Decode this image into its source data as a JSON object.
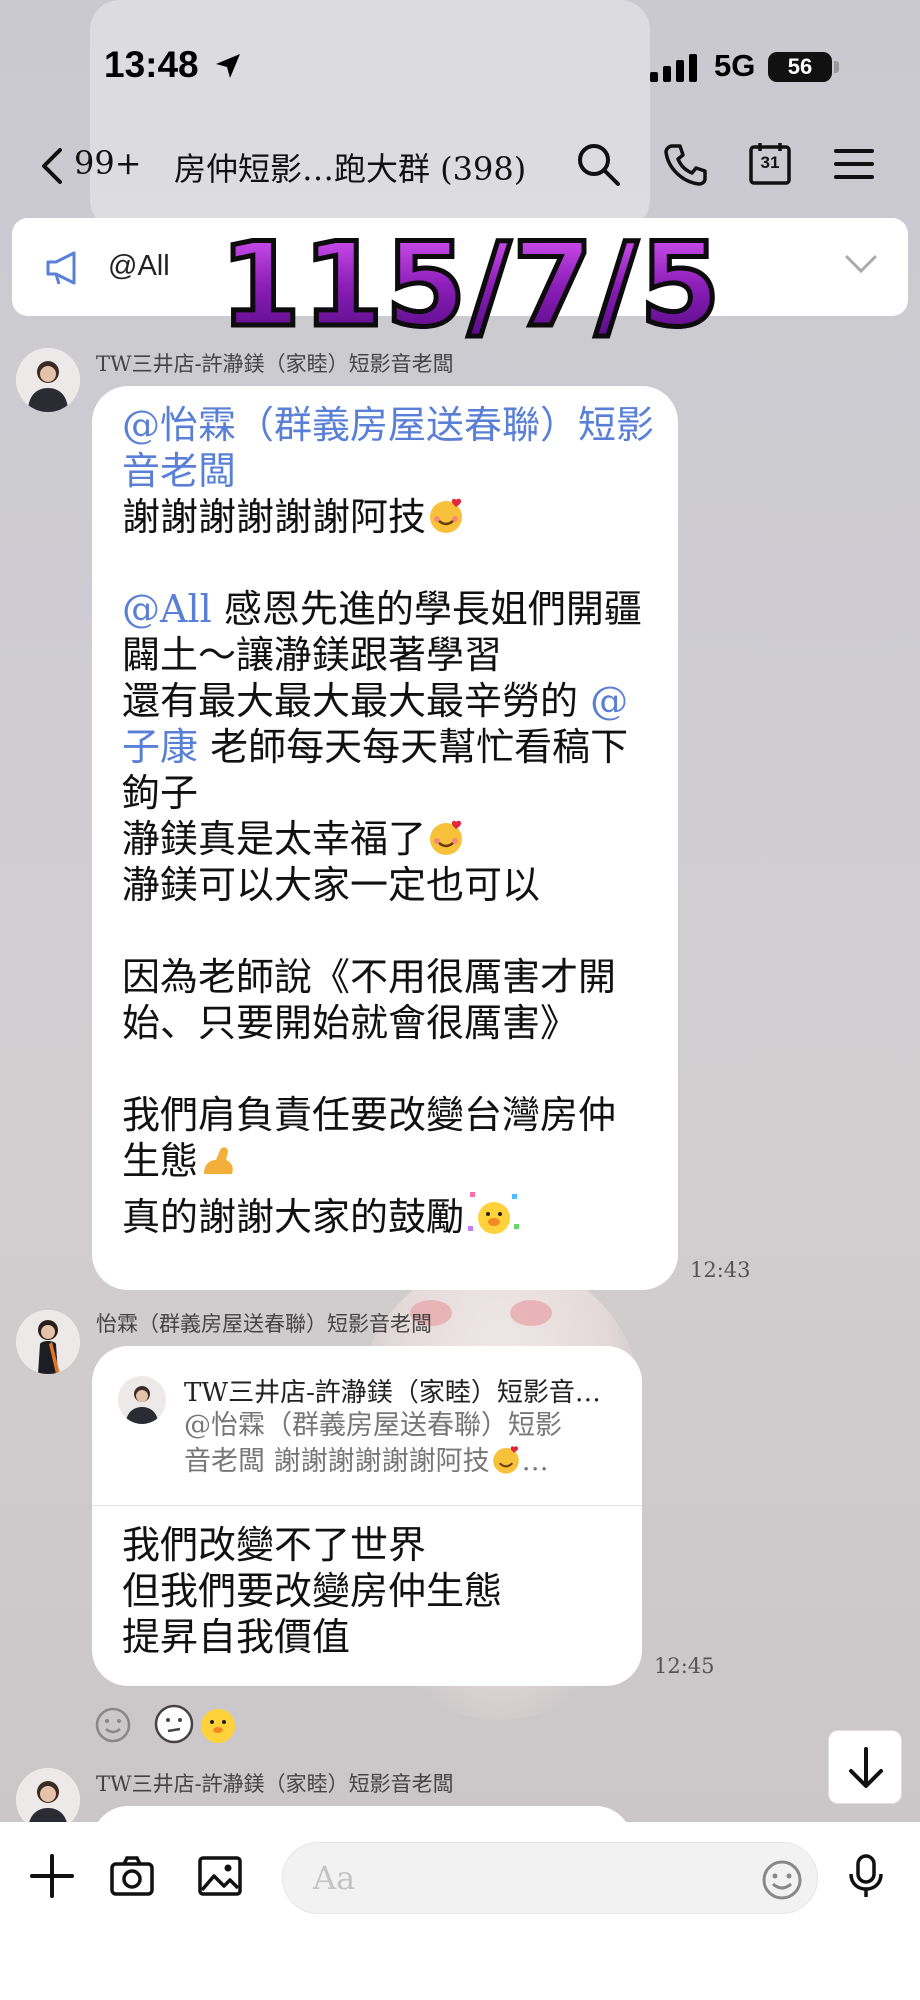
{
  "status_bar": {
    "time": "13:48",
    "network": "5G",
    "battery": "56"
  },
  "header": {
    "unread_count": "99+",
    "title": "房仲短影…跑大群 (398)",
    "calendar_day": "31"
  },
  "announcement": {
    "text": "@All"
  },
  "overlay_date": "115/7/5",
  "messages": [
    {
      "sender": "TW三井店-許瀞鎂（家睦）短影音老闆",
      "lines": [
        [
          "@怡霖（群義房屋送春聯）短影",
          ""
        ],
        [
          "音老闆",
          ""
        ],
        [
          "",
          "謝謝謝謝謝謝阿技"
        ],
        [
          "",
          ""
        ],
        [
          "@All",
          " 感恩先進的學長姐們開疆"
        ],
        [
          "",
          "闢土～讓瀞鎂跟著學習"
        ],
        [
          "",
          "還有最大最大最大最辛勞的 "
        ],
        [
          "子康",
          " 老師每天每天幫忙看稿下"
        ],
        [
          "",
          "鉤子"
        ],
        [
          "",
          "瀞鎂真是太幸福了"
        ],
        [
          "",
          "瀞鎂可以大家一定也可以"
        ],
        [
          "",
          ""
        ],
        [
          "",
          "因為老師說《不用很厲害才開"
        ],
        [
          "",
          "始、只要開始就會很厲害》"
        ],
        [
          "",
          ""
        ],
        [
          "",
          "我們肩負責任要改變台灣房仲"
        ],
        [
          "",
          "生態"
        ],
        [
          "",
          "真的謝謝大家的鼓勵"
        ]
      ],
      "mention_at_end_line7": "@",
      "time": "12:43"
    },
    {
      "sender": "怡霖（群義房屋送春聯）短影音老闆",
      "quote": {
        "name": "TW三井店-許瀞鎂（家睦）短影音…",
        "line1": "@怡霖（群義房屋送春聯）短影",
        "line2": "音老闆 謝謝謝謝謝謝阿技"
      },
      "lines": [
        "我們改變不了世界",
        "但我們要改變房仲生態",
        "提昇自我價值"
      ],
      "time": "12:45"
    },
    {
      "sender": "TW三井店-許瀞鎂（家睦）短影音老闆"
    }
  ],
  "input": {
    "placeholder": "Aa"
  },
  "colors": {
    "mention": "#5a7fd6",
    "bubble": "#ffffff",
    "overlay_gradient_top": "#e45fff",
    "overlay_gradient_bottom": "#4a067a"
  }
}
